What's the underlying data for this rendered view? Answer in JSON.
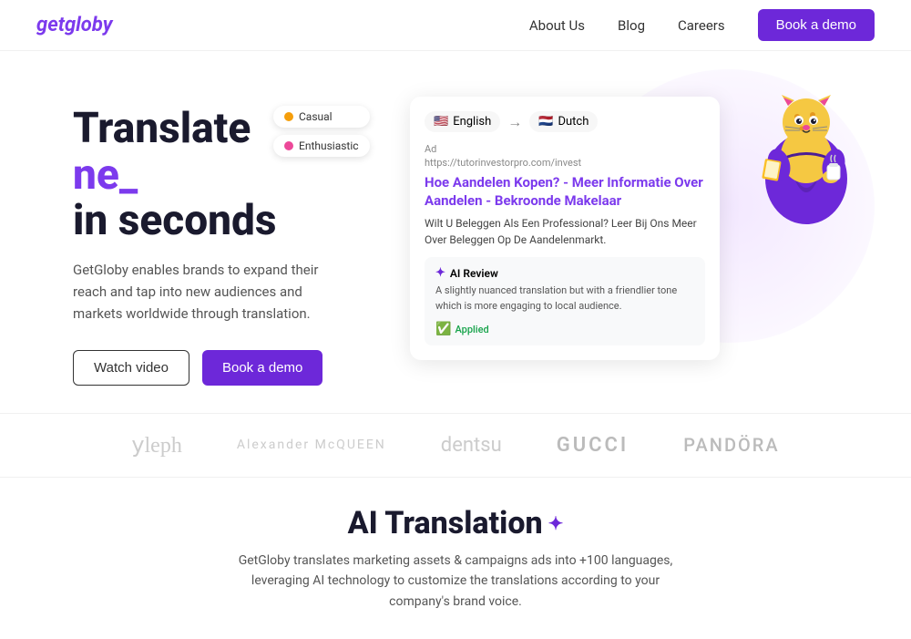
{
  "nav": {
    "logo": "getgloby",
    "links": [
      {
        "label": "About Us",
        "id": "about-us"
      },
      {
        "label": "Blog",
        "id": "blog"
      },
      {
        "label": "Careers",
        "id": "careers"
      }
    ],
    "cta": "Book a demo"
  },
  "hero": {
    "title_line1": "Translate",
    "title_line2": "ne_",
    "title_line3": "in seconds",
    "subtitle": "GetGloby enables brands to expand their reach and tap into new audiences and markets worldwide through translation.",
    "watch_label": "Watch video",
    "demo_label": "Book a demo"
  },
  "translation_card": {
    "source_lang": "English",
    "target_lang": "Dutch",
    "source_flag": "🇺🇸",
    "target_flag": "🇳🇱",
    "ad_label": "Ad",
    "ad_url": "https://tutorinvestorpro.com/invest",
    "ad_title": "Hoe Aandelen Kopen? - Meer Informatie Over Aandelen - Bekroonde Makelaar",
    "ad_body": "Wilt U Beleggen Als Een Professional? Leer Bij Ons Meer Over Beleggen Op De Aandelenmarkt.",
    "ai_review_header": "AI Review",
    "ai_review_text": "A slightly nuanced translation but with a friendlier tone which is more engaging to local audience.",
    "applied_label": "Applied",
    "tones": [
      {
        "label": "Casual",
        "color": "casual"
      },
      {
        "label": "Enthusiastic",
        "color": "enthusiastic"
      }
    ]
  },
  "logos": [
    {
      "label": "Aleph",
      "class": "logo-aleph"
    },
    {
      "label": "Alexander McQUEEN",
      "class": "logo-mcqueen"
    },
    {
      "label": "dentsu",
      "class": "logo-dentsu"
    },
    {
      "label": "GUCCI",
      "class": "logo-gucci"
    },
    {
      "label": "PANDÖRA",
      "class": "logo-pandora"
    }
  ],
  "bottom": {
    "title": "AI Translation",
    "subtitle": "GetGloby translates marketing assets & campaigns ads into +100 languages, leveraging AI technology to customize the translations according to your company's brand voice."
  }
}
